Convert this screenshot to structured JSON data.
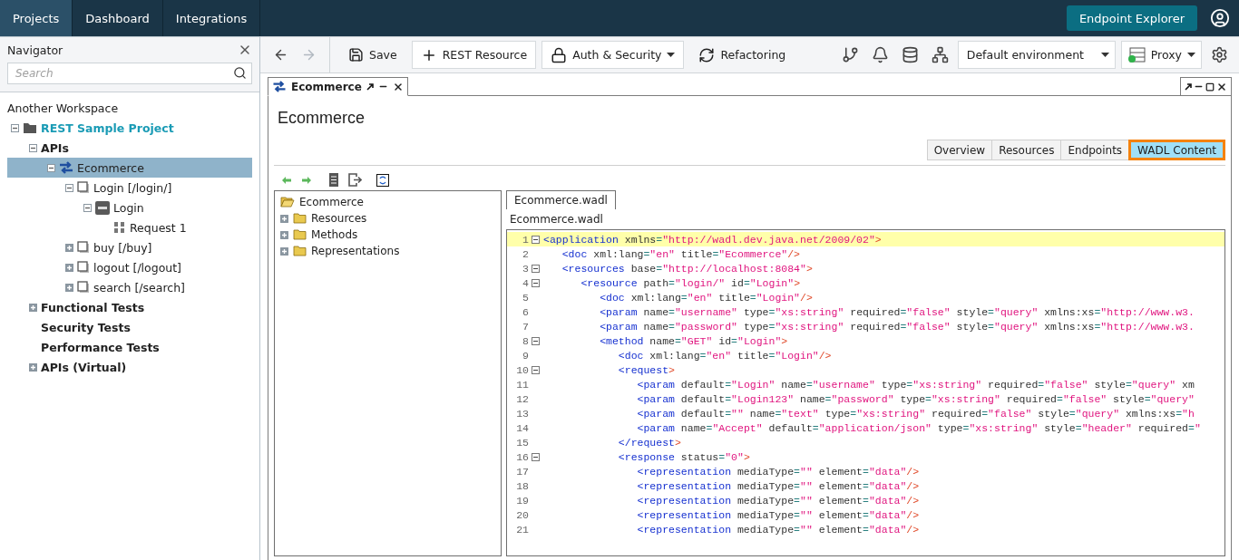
{
  "topbar": {
    "tabs": [
      {
        "label": "Projects",
        "selected": true
      },
      {
        "label": "Dashboard",
        "selected": false
      },
      {
        "label": "Integrations",
        "selected": false
      }
    ],
    "explorer_button": "Endpoint Explorer"
  },
  "navigator": {
    "title": "Navigator",
    "search": {
      "placeholder": "Search"
    },
    "tree": [
      {
        "label": "Another Workspace",
        "kind": "workspace",
        "selected": false,
        "children": [
          {
            "label": "REST Sample Project",
            "kind": "project",
            "selected": false,
            "expanded": true,
            "children": [
              {
                "label": "APIs",
                "kind": "group",
                "selected": false,
                "expanded": true,
                "children": [
                  {
                    "label": "Ecommerce",
                    "kind": "api",
                    "selected": true,
                    "expanded": true,
                    "children": [
                      {
                        "label": "Login [/login/]",
                        "kind": "resource",
                        "selected": false,
                        "expanded": true,
                        "children": [
                          {
                            "label": "Login",
                            "kind": "get",
                            "selected": false,
                            "expanded": true,
                            "children": [
                              {
                                "label": "Request 1",
                                "kind": "request",
                                "selected": false
                              }
                            ]
                          }
                        ]
                      },
                      {
                        "label": "buy [/buy]",
                        "kind": "resource",
                        "selected": false,
                        "expanded": false
                      },
                      {
                        "label": "logout [/logout]",
                        "kind": "resource",
                        "selected": false,
                        "expanded": false
                      },
                      {
                        "label": "search [/search]",
                        "kind": "resource",
                        "selected": false,
                        "expanded": false
                      }
                    ]
                  }
                ]
              },
              {
                "label": "Functional Tests",
                "kind": "group",
                "selected": false,
                "expanded": false
              },
              {
                "label": "Security Tests",
                "kind": "group",
                "selected": false
              },
              {
                "label": "Performance Tests",
                "kind": "group",
                "selected": false
              },
              {
                "label": "APIs (Virtual)",
                "kind": "group",
                "selected": false,
                "expanded": false
              }
            ]
          }
        ]
      }
    ]
  },
  "toolbar": {
    "buttons": [
      {
        "label": "Save",
        "kind": "save"
      },
      {
        "label": "REST Resource",
        "kind": "add"
      },
      {
        "label": "Auth & Security",
        "kind": "lock"
      },
      {
        "label": "Refactoring",
        "kind": "refresh"
      }
    ],
    "environment": "Default environment",
    "proxy": "Proxy"
  },
  "editor": {
    "tab": "Ecommerce",
    "title": "Ecommerce",
    "view_tabs": [
      {
        "label": "Overview",
        "selected": false
      },
      {
        "label": "Resources",
        "selected": false
      },
      {
        "label": "Endpoints",
        "selected": false
      },
      {
        "label": "WADL Content",
        "selected": true
      }
    ],
    "outline": [
      {
        "label": "Ecommerce",
        "kind": "open",
        "expanded": true
      },
      {
        "label": "Resources",
        "kind": "folder",
        "expanded": false
      },
      {
        "label": "Methods",
        "kind": "folder",
        "expanded": false
      },
      {
        "label": "Representations",
        "kind": "folder",
        "expanded": false
      }
    ],
    "file_tab": "Ecommerce.wadl",
    "file_label": "Ecommerce.wadl",
    "lines": [
      {
        "number": "1",
        "text": "<application xmlns=\"http://wadl.dev.java.net/2009/02\">",
        "foldable": true,
        "highlighted": true
      },
      {
        "number": "2",
        "text": "   <doc xml:lang=\"en\" title=\"Ecommerce\"/>",
        "foldable": false,
        "highlighted": false
      },
      {
        "number": "3",
        "text": "   <resources base=\"http://localhost:8084\">",
        "foldable": true,
        "highlighted": false
      },
      {
        "number": "4",
        "text": "      <resource path=\"login/\" id=\"Login\">",
        "foldable": true,
        "highlighted": false
      },
      {
        "number": "5",
        "text": "         <doc xml:lang=\"en\" title=\"Login\"/>",
        "foldable": false,
        "highlighted": false
      },
      {
        "number": "6",
        "text": "         <param name=\"username\" type=\"xs:string\" required=\"false\" style=\"query\" xmlns:xs=\"http://www.w3.",
        "foldable": false,
        "highlighted": false
      },
      {
        "number": "7",
        "text": "         <param name=\"password\" type=\"xs:string\" required=\"false\" style=\"query\" xmlns:xs=\"http://www.w3.",
        "foldable": false,
        "highlighted": false
      },
      {
        "number": "8",
        "text": "         <method name=\"GET\" id=\"Login\">",
        "foldable": true,
        "highlighted": false
      },
      {
        "number": "9",
        "text": "            <doc xml:lang=\"en\" title=\"Login\"/>",
        "foldable": false,
        "highlighted": false
      },
      {
        "number": "10",
        "text": "            <request>",
        "foldable": true,
        "highlighted": false
      },
      {
        "number": "11",
        "text": "               <param default=\"Login\" name=\"username\" type=\"xs:string\" required=\"false\" style=\"query\" xm",
        "foldable": false,
        "highlighted": false
      },
      {
        "number": "12",
        "text": "               <param default=\"Login123\" name=\"password\" type=\"xs:string\" required=\"false\" style=\"query\"",
        "foldable": false,
        "highlighted": false
      },
      {
        "number": "13",
        "text": "               <param default=\"\" name=\"text\" type=\"xs:string\" required=\"false\" style=\"query\" xmlns:xs=\"h",
        "foldable": false,
        "highlighted": false
      },
      {
        "number": "14",
        "text": "               <param name=\"Accept\" default=\"application/json\" type=\"xs:string\" style=\"header\" required=\"",
        "foldable": false,
        "highlighted": false
      },
      {
        "number": "15",
        "text": "            </request>",
        "foldable": false,
        "highlighted": false
      },
      {
        "number": "16",
        "text": "            <response status=\"0\">",
        "foldable": true,
        "highlighted": false
      },
      {
        "number": "17",
        "text": "               <representation mediaType=\"\" element=\"data\"/>",
        "foldable": false,
        "highlighted": false
      },
      {
        "number": "18",
        "text": "               <representation mediaType=\"\" element=\"data\"/>",
        "foldable": false,
        "highlighted": false
      },
      {
        "number": "19",
        "text": "               <representation mediaType=\"\" element=\"data\"/>",
        "foldable": false,
        "highlighted": false
      },
      {
        "number": "20",
        "text": "               <representation mediaType=\"\" element=\"data\"/>",
        "foldable": false,
        "highlighted": false
      },
      {
        "number": "21",
        "text": "               <representation mediaType=\"\" element=\"data\"/>",
        "foldable": false,
        "highlighted": false
      }
    ]
  }
}
